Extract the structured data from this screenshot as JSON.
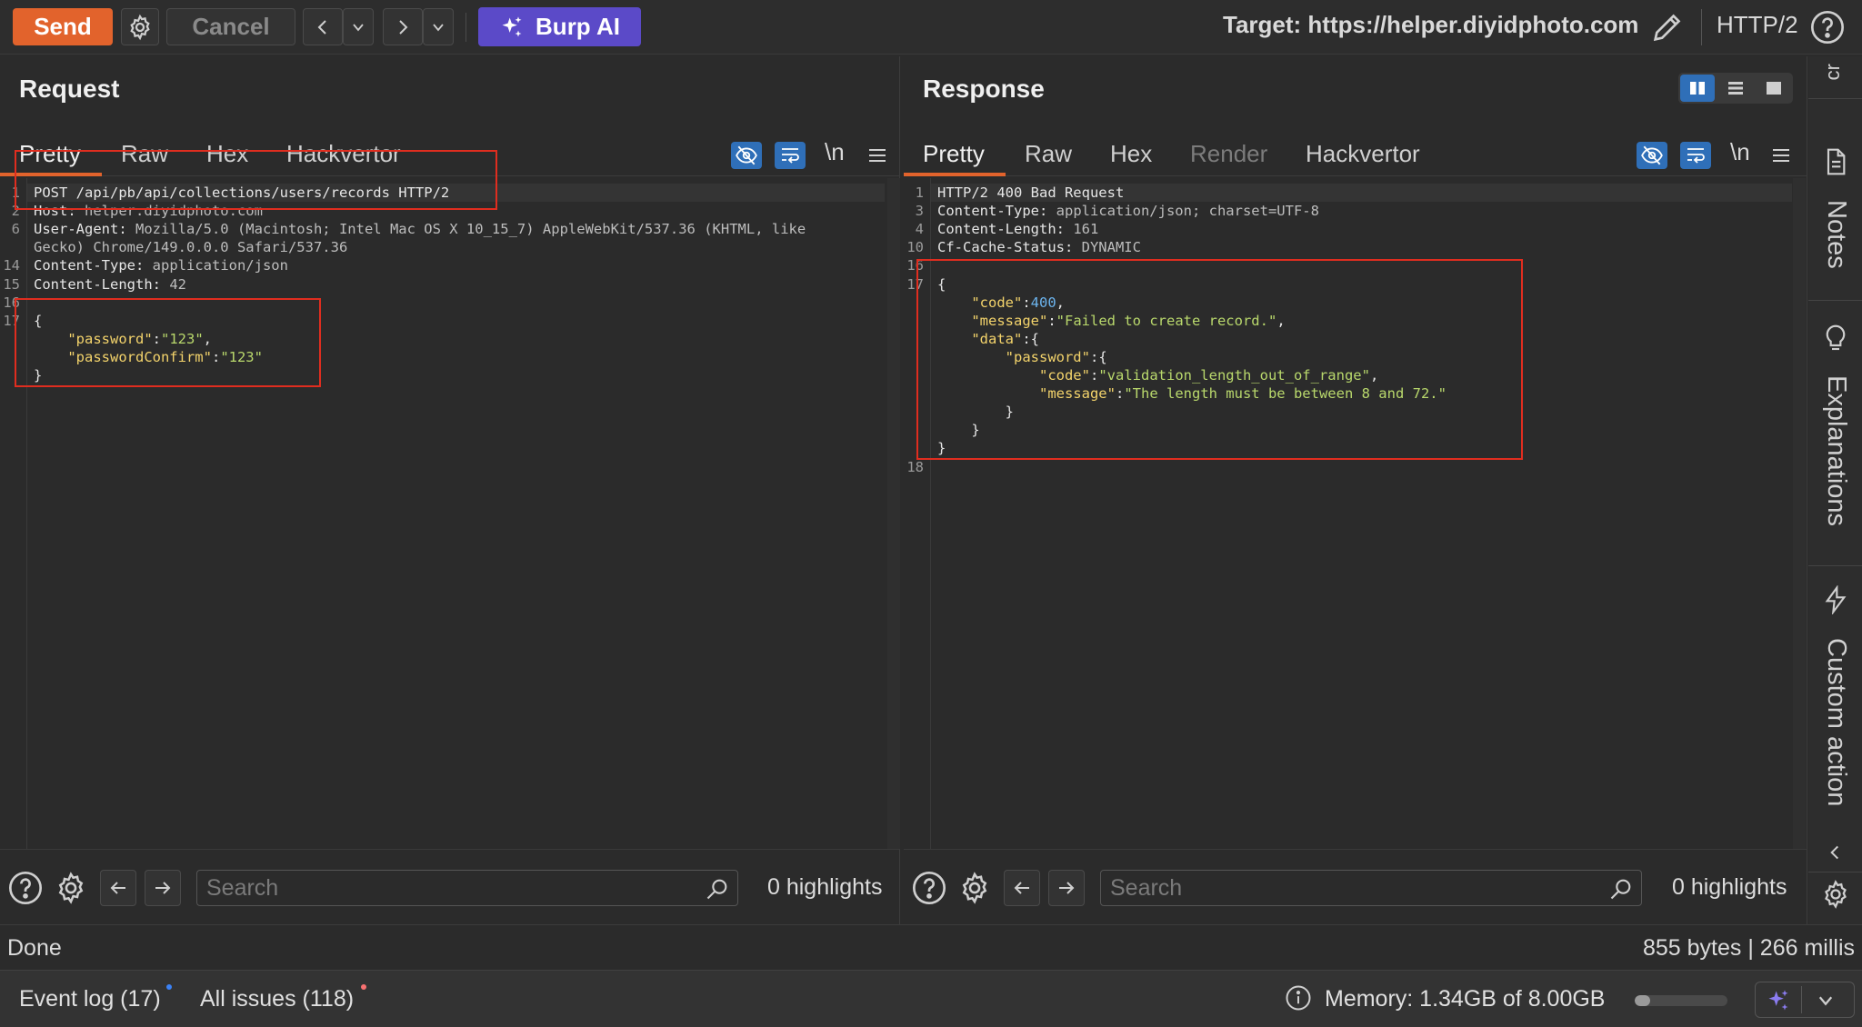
{
  "toolbar": {
    "send_label": "Send",
    "cancel_label": "Cancel",
    "burp_ai_label": "Burp AI",
    "target_label": "Target: https://helper.diyidphoto.com",
    "protocol_label": "HTTP/2"
  },
  "request": {
    "title": "Request",
    "tabs": [
      "Pretty",
      "Raw",
      "Hex",
      "Hackvertor"
    ],
    "active_tab": "Pretty",
    "newline_toggle": "\\n",
    "lines": [
      {
        "n": "1",
        "kind": "req",
        "text": "POST /api/pb/api/collections/users/records HTTP/2"
      },
      {
        "n": "2",
        "kind": "hdr",
        "key": "Host:",
        "val": " helper.diyidphoto.com"
      },
      {
        "n": "6",
        "kind": "hdr",
        "key": "User-Agent:",
        "val": " Mozilla/5.0 (Macintosh; Intel Mac OS X 10_15_7) AppleWebKit/537.36 (KHTML, like"
      },
      {
        "n": "",
        "kind": "cont",
        "text": "Gecko) Chrome/149.0.0.0 Safari/537.36"
      },
      {
        "n": "14",
        "kind": "hdr",
        "key": "Content-Type:",
        "val": " application/json"
      },
      {
        "n": "15",
        "kind": "hdr",
        "key": "Content-Length:",
        "val": " 42"
      },
      {
        "n": "16",
        "kind": "blank",
        "text": ""
      },
      {
        "n": "17",
        "kind": "plain",
        "text": "{"
      },
      {
        "n": "",
        "kind": "jkv",
        "indent": "    ",
        "key": "\"password\"",
        "sep": ":",
        "val": "\"123\"",
        "vtype": "s",
        "tail": ","
      },
      {
        "n": "",
        "kind": "jkv",
        "indent": "    ",
        "key": "\"passwordConfirm\"",
        "sep": ":",
        "val": "\"123\"",
        "vtype": "s",
        "tail": ""
      },
      {
        "n": "",
        "kind": "plain",
        "text": "}"
      }
    ],
    "search_placeholder": "Search",
    "highlights": "0 highlights"
  },
  "response": {
    "title": "Response",
    "tabs": [
      "Pretty",
      "Raw",
      "Hex",
      "Render",
      "Hackvertor"
    ],
    "active_tab": "Pretty",
    "disabled_tab": "Render",
    "newline_toggle": "\\n",
    "lines": [
      {
        "n": "1",
        "kind": "req",
        "text": "HTTP/2 400 Bad Request"
      },
      {
        "n": "3",
        "kind": "hdr",
        "key": "Content-Type:",
        "val": " application/json; charset=UTF-8"
      },
      {
        "n": "4",
        "kind": "hdr",
        "key": "Content-Length:",
        "val": " 161"
      },
      {
        "n": "10",
        "kind": "hdr",
        "key": "Cf-Cache-Status:",
        "val": " DYNAMIC"
      },
      {
        "n": "16",
        "kind": "blank",
        "text": ""
      },
      {
        "n": "17",
        "kind": "plain",
        "text": "{"
      },
      {
        "n": "",
        "kind": "jkv",
        "indent": "    ",
        "key": "\"code\"",
        "sep": ":",
        "val": "400",
        "vtype": "n",
        "tail": ","
      },
      {
        "n": "",
        "kind": "jkv",
        "indent": "    ",
        "key": "\"message\"",
        "sep": ":",
        "val": "\"Failed to create record.\"",
        "vtype": "s",
        "tail": ","
      },
      {
        "n": "",
        "kind": "jkv",
        "indent": "    ",
        "key": "\"data\"",
        "sep": ":{",
        "val": "",
        "vtype": "s",
        "tail": ""
      },
      {
        "n": "",
        "kind": "jkv",
        "indent": "        ",
        "key": "\"password\"",
        "sep": ":{",
        "val": "",
        "vtype": "s",
        "tail": ""
      },
      {
        "n": "",
        "kind": "jkv",
        "indent": "            ",
        "key": "\"code\"",
        "sep": ":",
        "val": "\"validation_length_out_of_range\"",
        "vtype": "s",
        "tail": ","
      },
      {
        "n": "",
        "kind": "jkv",
        "indent": "            ",
        "key": "\"message\"",
        "sep": ":",
        "val": "\"The length must be between 8 and 72.\"",
        "vtype": "s",
        "tail": ""
      },
      {
        "n": "",
        "kind": "plain",
        "text": "        }"
      },
      {
        "n": "",
        "kind": "plain",
        "text": "    }"
      },
      {
        "n": "",
        "kind": "plain",
        "text": "}"
      },
      {
        "n": "18",
        "kind": "blank",
        "text": ""
      }
    ],
    "search_placeholder": "Search",
    "highlights": "0 highlights"
  },
  "side_panel": {
    "top_label": "ɹɔ",
    "items": [
      "Notes",
      "Explanations",
      "Custom action"
    ]
  },
  "status": {
    "left": "Done",
    "right": "855 bytes | 266 millis"
  },
  "footer": {
    "event_log": "Event log (17)",
    "all_issues": "All issues (118)",
    "memory": "Memory: 1.34GB of 8.00GB",
    "memory_fraction": 0.1675
  },
  "colors": {
    "accent": "#e2632c",
    "burp_ai": "#5b4ac8",
    "highlight_box": "#e02d1f",
    "toggle_blue": "#2f6fb8",
    "event_dot": "#3b82f6",
    "issues_dot": "#f87171"
  }
}
